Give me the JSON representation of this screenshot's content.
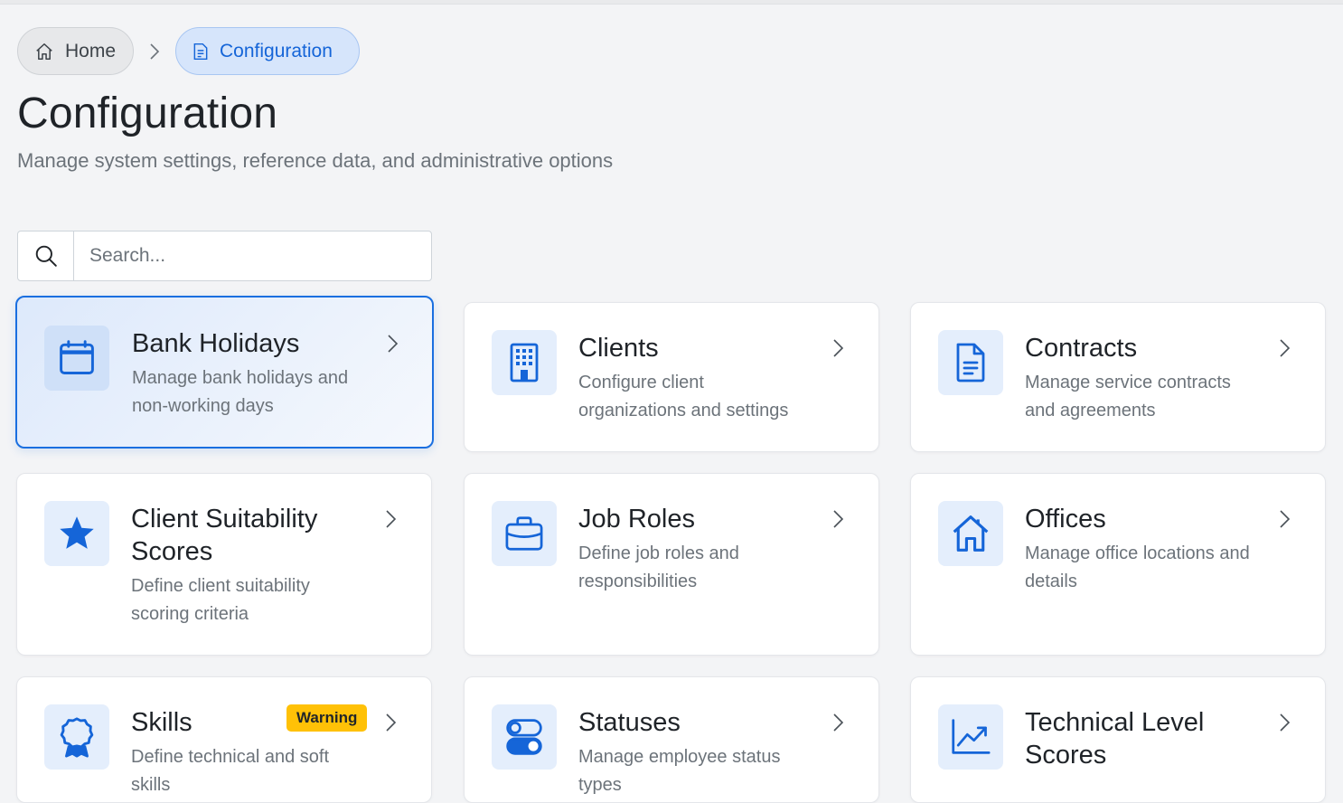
{
  "breadcrumb": {
    "home": "Home",
    "current": "Configuration"
  },
  "header": {
    "title": "Configuration",
    "subtitle": "Manage system settings, reference data, and administrative options"
  },
  "search": {
    "placeholder": "Search...",
    "value": ""
  },
  "cards": [
    {
      "title": "Bank Holidays",
      "desc_1": "Manage bank holidays and",
      "desc_2": "non-working days",
      "icon": "calendar-icon",
      "active": true
    },
    {
      "title": "Clients",
      "desc_1": "Configure client",
      "desc_2": "organizations and settings",
      "icon": "building-icon"
    },
    {
      "title": "Contracts",
      "desc_1": "Manage service contracts",
      "desc_2": "and agreements",
      "icon": "document-icon"
    },
    {
      "title_1": "Client Suitability",
      "title_2": "Scores",
      "desc_1": "Define client suitability",
      "desc_2": "scoring criteria",
      "icon": "star-icon"
    },
    {
      "title": "Job Roles",
      "desc_1": "Define job roles and",
      "desc_2": "responsibilities",
      "icon": "briefcase-icon"
    },
    {
      "title": "Offices",
      "desc_1": "Manage office locations and",
      "desc_2": "details",
      "icon": "house-icon"
    },
    {
      "title": "Skills",
      "badge": "Warning",
      "desc_1": "Define technical and soft",
      "desc_2": "skills",
      "icon": "award-icon"
    },
    {
      "title": "Statuses",
      "desc_1": "Manage employee status",
      "desc_2": "types",
      "icon": "toggles-icon"
    },
    {
      "title_1": "Technical Level",
      "title_2": "Scores",
      "icon": "graph-up-icon"
    }
  ],
  "colors": {
    "accent": "#1565d8",
    "icon_bg": "#e4eefc",
    "badge": "#ffc107"
  }
}
